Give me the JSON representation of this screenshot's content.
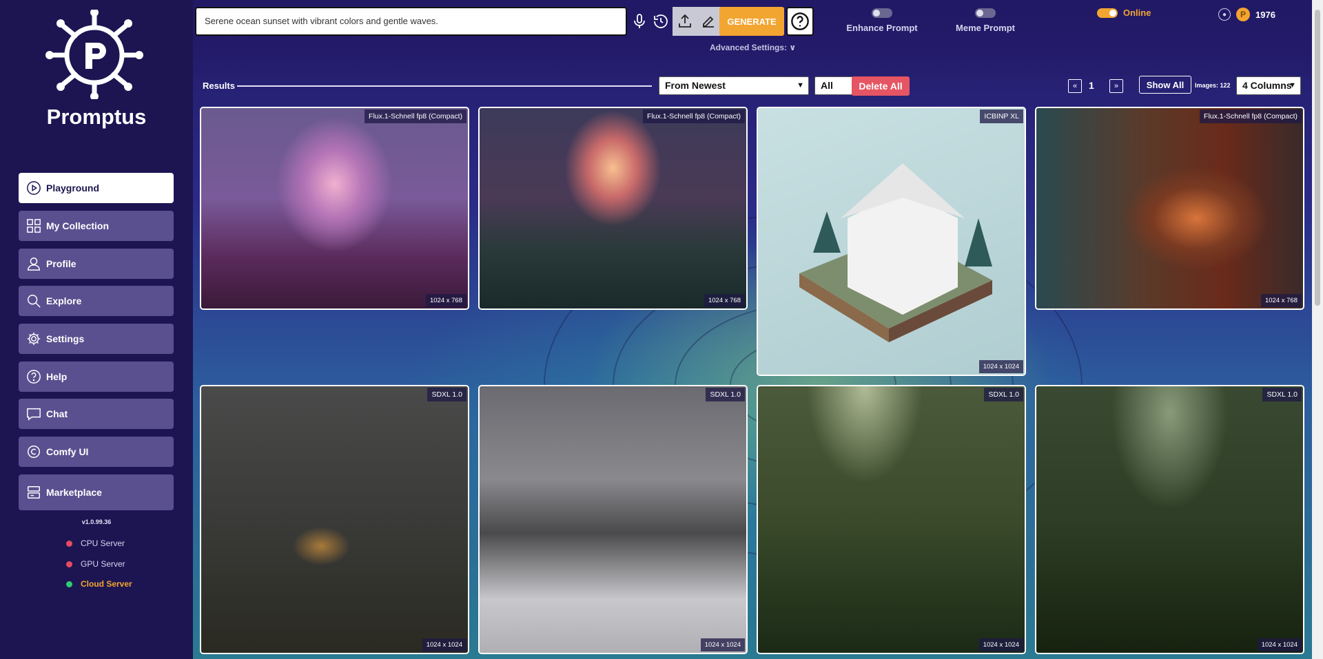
{
  "sidebar": {
    "brand": "Promptus",
    "items": [
      {
        "label": "Playground",
        "icon": "play-icon"
      },
      {
        "label": "My Collection",
        "icon": "grid-icon"
      },
      {
        "label": "Profile",
        "icon": "user-icon"
      },
      {
        "label": "Explore",
        "icon": "search-icon"
      },
      {
        "label": "Settings",
        "icon": "gear-icon"
      },
      {
        "label": "Help",
        "icon": "question-icon"
      },
      {
        "label": "Chat",
        "icon": "chat-icon"
      },
      {
        "label": "Comfy UI",
        "icon": "comfy-icon"
      },
      {
        "label": "Marketplace",
        "icon": "store-icon"
      }
    ],
    "version": "v1.0.99.36",
    "servers": [
      {
        "label": "CPU Server",
        "color": "#e84a5f"
      },
      {
        "label": "GPU Server",
        "color": "#e84a5f"
      },
      {
        "label": "Cloud Server",
        "color": "#2ecc71"
      }
    ]
  },
  "topbar": {
    "prompt_value": "Serene ocean sunset with vibrant colors and gentle waves.",
    "generate_label": "GENERATE",
    "enhance_label": "Enhance Prompt",
    "meme_label": "Meme Prompt",
    "online_label": "Online",
    "credits": "1976",
    "advanced_label": "Advanced Settings:"
  },
  "results": {
    "label": "Results",
    "sort_value": "From Newest",
    "filter_value": "All",
    "delete_label": "Delete All",
    "page": "1",
    "show_all_label": "Show All",
    "images_count": "Images: 122",
    "columns_value": "4 Columns"
  },
  "cards": [
    {
      "model": "Flux.1-Schnell fp8 (Compact)",
      "size": "1024 x 768"
    },
    {
      "model": "Flux.1-Schnell fp8 (Compact)",
      "size": "1024 x 768"
    },
    {
      "model": "ICBINP XL",
      "size": "1024 x 1024"
    },
    {
      "model": "Flux.1-Schnell fp8 (Compact)",
      "size": "1024 x 768"
    },
    {
      "model": "SDXL 1.0",
      "size": "1024 x 1024"
    },
    {
      "model": "SDXL 1.0",
      "size": "1024 x 1024"
    },
    {
      "model": "SDXL 1.0",
      "size": "1024 x 1024"
    },
    {
      "model": "SDXL 1.0",
      "size": "1024 x 1024"
    }
  ],
  "colors": {
    "accent": "#f3a531",
    "danger": "#e55563",
    "sidebar_bg": "#1c1552",
    "nav_bg": "#5a5090"
  }
}
